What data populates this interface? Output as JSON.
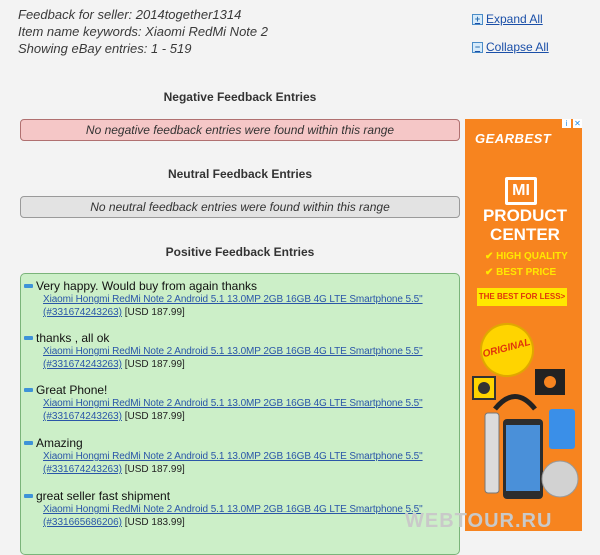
{
  "header": {
    "seller_line": "Feedback for seller: 2014together1314",
    "keywords_line": "Item name keywords: Xiaomi RedMi Note 2",
    "showing_line": "Showing eBay entries: 1 - 519"
  },
  "controls": {
    "expand_all": "Expand All",
    "collapse_all": "Collapse All"
  },
  "negative": {
    "title": "Negative Feedback Entries",
    "message": "No negative feedback entries were found within this range"
  },
  "neutral": {
    "title": "Neutral Feedback Entries",
    "message": "No neutral feedback entries were found within this range"
  },
  "positive": {
    "title": "Positive Feedback Entries",
    "entries": [
      {
        "comment": "Very happy. Would buy from again thanks",
        "item": "Xiaomi Hongmi RedMi Note 2 Android 5.1 13.0MP 2GB 16GB 4G LTE Smartphone 5.5\"",
        "item_id": "(#331674243263)",
        "price": "[USD 187.99]"
      },
      {
        "comment": "thanks , all ok",
        "item": "Xiaomi Hongmi RedMi Note 2 Android 5.1 13.0MP 2GB 16GB 4G LTE Smartphone 5.5\"",
        "item_id": "(#331674243263)",
        "price": "[USD 187.99]"
      },
      {
        "comment": "Great Phone!",
        "item": "Xiaomi Hongmi RedMi Note 2 Android 5.1 13.0MP 2GB 16GB 4G LTE Smartphone 5.5\"",
        "item_id": "(#331674243263)",
        "price": "[USD 187.99]"
      },
      {
        "comment": "Amazing",
        "item": "Xiaomi Hongmi RedMi Note 2 Android 5.1 13.0MP 2GB 16GB 4G LTE Smartphone 5.5\"",
        "item_id": "(#331674243263)",
        "price": "[USD 187.99]"
      },
      {
        "comment": "great seller fast shipment",
        "item": "Xiaomi Hongmi RedMi Note 2 Android 5.1 13.0MP 2GB 16GB 4G LTE Smartphone 5.5\"",
        "item_id": "(#331665686206)",
        "price": "[USD 183.99]"
      }
    ]
  },
  "ad": {
    "brand": "GEARBEST",
    "logo": "MI",
    "headline": "PRODUCT CENTER",
    "bullet1": "HIGH QUALITY",
    "bullet2": "BEST PRICE",
    "cta": "THE BEST FOR LESS>",
    "badge": "ORIGINAL"
  },
  "watermark": "WEBTOUR.RU"
}
